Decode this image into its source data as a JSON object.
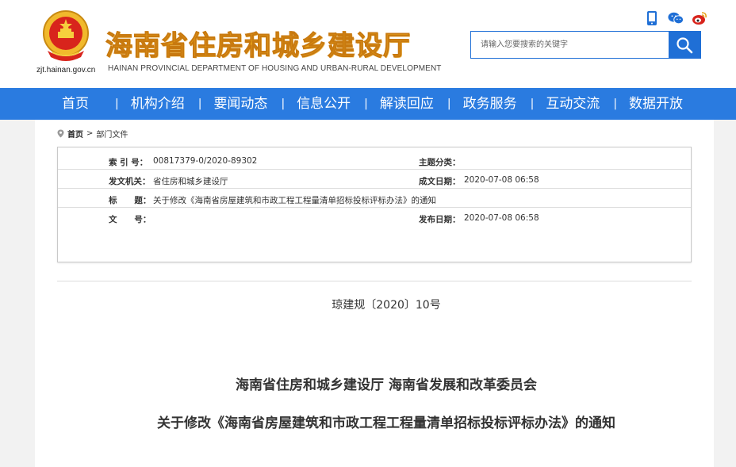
{
  "header": {
    "domain": "zjt.hainan.gov.cn",
    "title": "海南省住房和城乡建设厅",
    "subtitle": "HAINAN PROVINCIAL DEPARTMENT OF HOUSING AND URBAN-RURAL DEVELOPMENT",
    "icons": [
      "mobile-icon",
      "wechat-icon",
      "weibo-icon"
    ],
    "search": {
      "placeholder": "请输入您要搜索的关键字"
    }
  },
  "nav": {
    "items": [
      {
        "label": "首页"
      },
      {
        "label": "机构介绍"
      },
      {
        "label": "要闻动态"
      },
      {
        "label": "信息公开"
      },
      {
        "label": "解读回应"
      },
      {
        "label": "政务服务"
      },
      {
        "label": "互动交流"
      },
      {
        "label": "数据开放"
      }
    ],
    "separator": "|"
  },
  "breadcrumb": {
    "home": "首页",
    "sep": ">",
    "current": "部门文件"
  },
  "meta": {
    "index_label": "索  引 号：",
    "index_value": "00817379-0/2020-89302",
    "category_label": "主题分类：",
    "category_value": "",
    "issuer_label": "发文机关：",
    "issuer_value": "省住房和城乡建设厅",
    "date_label": "成文日期：",
    "date_value": "2020-07-08 06:58",
    "title_label": "标      题：",
    "title_value": "关于修改《海南省房屋建筑和市政工程工程量清单招标投标评标办法》的通知",
    "docno_label": "文      号：",
    "docno_value": "",
    "pubdate_label": "发布日期：",
    "pubdate_value": "2020-07-08 06:58"
  },
  "doc": {
    "number": "琼建规〔2020〕10号",
    "title1": "海南省住房和城乡建设厅 海南省发展和改革委员会",
    "title2": "关于修改《海南省房屋建筑和市政工程工程量清单招标投标评标办法》的通知"
  },
  "colors": {
    "nav_bg": "#2a7be0",
    "title_gold": "#e7a21b",
    "emblem_red": "#d8241c"
  }
}
